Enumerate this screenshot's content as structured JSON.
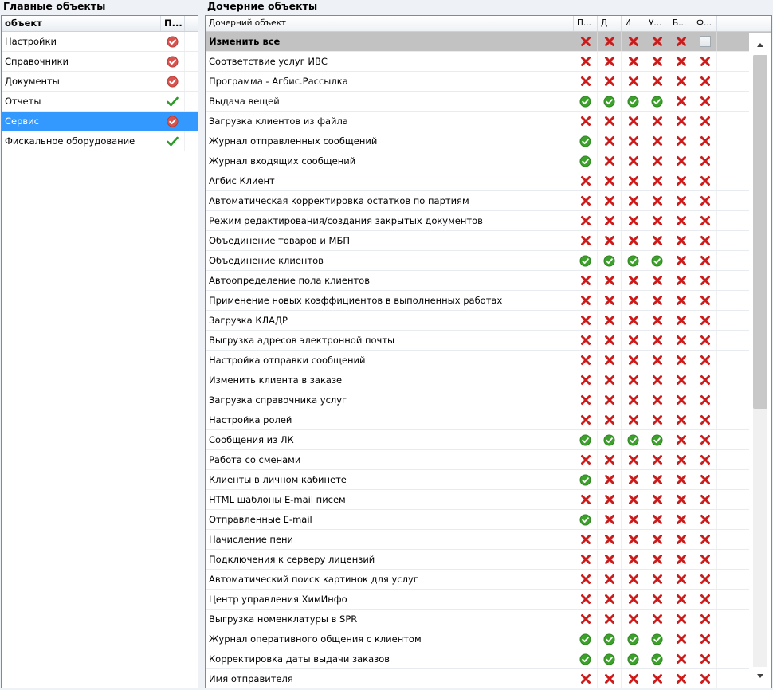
{
  "left": {
    "title": "Главные объекты",
    "col_name": "объект",
    "col_perm": "П...",
    "rows": [
      {
        "name": "Настройки",
        "perm": "mixed"
      },
      {
        "name": "Справочники",
        "perm": "mixed"
      },
      {
        "name": "Документы",
        "perm": "mixed"
      },
      {
        "name": "Отчеты",
        "perm": "check"
      },
      {
        "name": "Сервис",
        "perm": "mixed",
        "selected": true
      },
      {
        "name": "Фискальное оборудование",
        "perm": "check"
      }
    ]
  },
  "right": {
    "title": "Дочерние объекты",
    "col_name": "Дочерний объект",
    "flag_cols": [
      "П...",
      "Д",
      "И",
      "У...",
      "Б...",
      "Ф..."
    ],
    "master_row": {
      "name": "Изменить все",
      "flags": [
        "x",
        "x",
        "x",
        "x",
        "x",
        "box"
      ]
    },
    "rows": [
      {
        "name": "Соответствие услуг ИВС",
        "flags": [
          "x",
          "x",
          "x",
          "x",
          "x",
          "x"
        ]
      },
      {
        "name": "Программа - Агбис.Рассылка",
        "flags": [
          "x",
          "x",
          "x",
          "x",
          "x",
          "x"
        ]
      },
      {
        "name": "Выдача вещей",
        "flags": [
          "ok",
          "ok",
          "ok",
          "ok",
          "x",
          "x"
        ]
      },
      {
        "name": "Загрузка клиентов из файла",
        "flags": [
          "x",
          "x",
          "x",
          "x",
          "x",
          "x"
        ]
      },
      {
        "name": "Журнал отправленных сообщений",
        "flags": [
          "ok",
          "x",
          "x",
          "x",
          "x",
          "x"
        ]
      },
      {
        "name": "Журнал входящих сообщений",
        "flags": [
          "ok",
          "x",
          "x",
          "x",
          "x",
          "x"
        ]
      },
      {
        "name": "Агбис Клиент",
        "flags": [
          "x",
          "x",
          "x",
          "x",
          "x",
          "x"
        ]
      },
      {
        "name": "Автоматическая корректировка остатков по партиям",
        "flags": [
          "x",
          "x",
          "x",
          "x",
          "x",
          "x"
        ]
      },
      {
        "name": "Режим редактирования/создания закрытых документов",
        "flags": [
          "x",
          "x",
          "x",
          "x",
          "x",
          "x"
        ]
      },
      {
        "name": "Объединение товаров и МБП",
        "flags": [
          "x",
          "x",
          "x",
          "x",
          "x",
          "x"
        ]
      },
      {
        "name": "Объединение клиентов",
        "flags": [
          "ok",
          "ok",
          "ok",
          "ok",
          "x",
          "x"
        ]
      },
      {
        "name": "Автоопределение пола клиентов",
        "flags": [
          "x",
          "x",
          "x",
          "x",
          "x",
          "x"
        ]
      },
      {
        "name": "Применение новых коэффициентов в выполненных работах",
        "flags": [
          "x",
          "x",
          "x",
          "x",
          "x",
          "x"
        ]
      },
      {
        "name": "Загрузка КЛАДР",
        "flags": [
          "x",
          "x",
          "x",
          "x",
          "x",
          "x"
        ]
      },
      {
        "name": "Выгрузка адресов электронной почты",
        "flags": [
          "x",
          "x",
          "x",
          "x",
          "x",
          "x"
        ]
      },
      {
        "name": "Настройка отправки сообщений",
        "flags": [
          "x",
          "x",
          "x",
          "x",
          "x",
          "x"
        ]
      },
      {
        "name": "Изменить клиента в заказе",
        "flags": [
          "x",
          "x",
          "x",
          "x",
          "x",
          "x"
        ]
      },
      {
        "name": "Загрузка справочника услуг",
        "flags": [
          "x",
          "x",
          "x",
          "x",
          "x",
          "x"
        ]
      },
      {
        "name": "Настройка ролей",
        "flags": [
          "x",
          "x",
          "x",
          "x",
          "x",
          "x"
        ]
      },
      {
        "name": "Сообщения из ЛК",
        "flags": [
          "ok",
          "ok",
          "ok",
          "ok",
          "x",
          "x"
        ]
      },
      {
        "name": "Работа со сменами",
        "flags": [
          "x",
          "x",
          "x",
          "x",
          "x",
          "x"
        ]
      },
      {
        "name": "Клиенты в личном кабинете",
        "flags": [
          "ok",
          "x",
          "x",
          "x",
          "x",
          "x"
        ]
      },
      {
        "name": "HTML шаблоны E-mail писем",
        "flags": [
          "x",
          "x",
          "x",
          "x",
          "x",
          "x"
        ]
      },
      {
        "name": "Отправленные E-mail",
        "flags": [
          "ok",
          "x",
          "x",
          "x",
          "x",
          "x"
        ]
      },
      {
        "name": "Начисление пени",
        "flags": [
          "x",
          "x",
          "x",
          "x",
          "x",
          "x"
        ]
      },
      {
        "name": "Подключения к серверу лицензий",
        "flags": [
          "x",
          "x",
          "x",
          "x",
          "x",
          "x"
        ]
      },
      {
        "name": "Автоматический поиск картинок для услуг",
        "flags": [
          "x",
          "x",
          "x",
          "x",
          "x",
          "x"
        ]
      },
      {
        "name": "Центр управления ХимИнфо",
        "flags": [
          "x",
          "x",
          "x",
          "x",
          "x",
          "x"
        ]
      },
      {
        "name": "Выгрузка номенклатуры в SPR",
        "flags": [
          "x",
          "x",
          "x",
          "x",
          "x",
          "x"
        ]
      },
      {
        "name": "Журнал оперативного общения с клиентом",
        "flags": [
          "ok",
          "ok",
          "ok",
          "ok",
          "x",
          "x"
        ]
      },
      {
        "name": "Корректировка даты выдачи заказов",
        "flags": [
          "ok",
          "ok",
          "ok",
          "ok",
          "x",
          "x"
        ]
      },
      {
        "name": "Имя отправителя",
        "flags": [
          "x",
          "x",
          "x",
          "x",
          "x",
          "x"
        ]
      }
    ]
  },
  "colors": {
    "selected": "#3399ff",
    "x_red": "#cc1b1b",
    "ok_green": "#3ca12a",
    "mixed_red": "#d9534f",
    "master_bg": "#c2c2c2"
  }
}
